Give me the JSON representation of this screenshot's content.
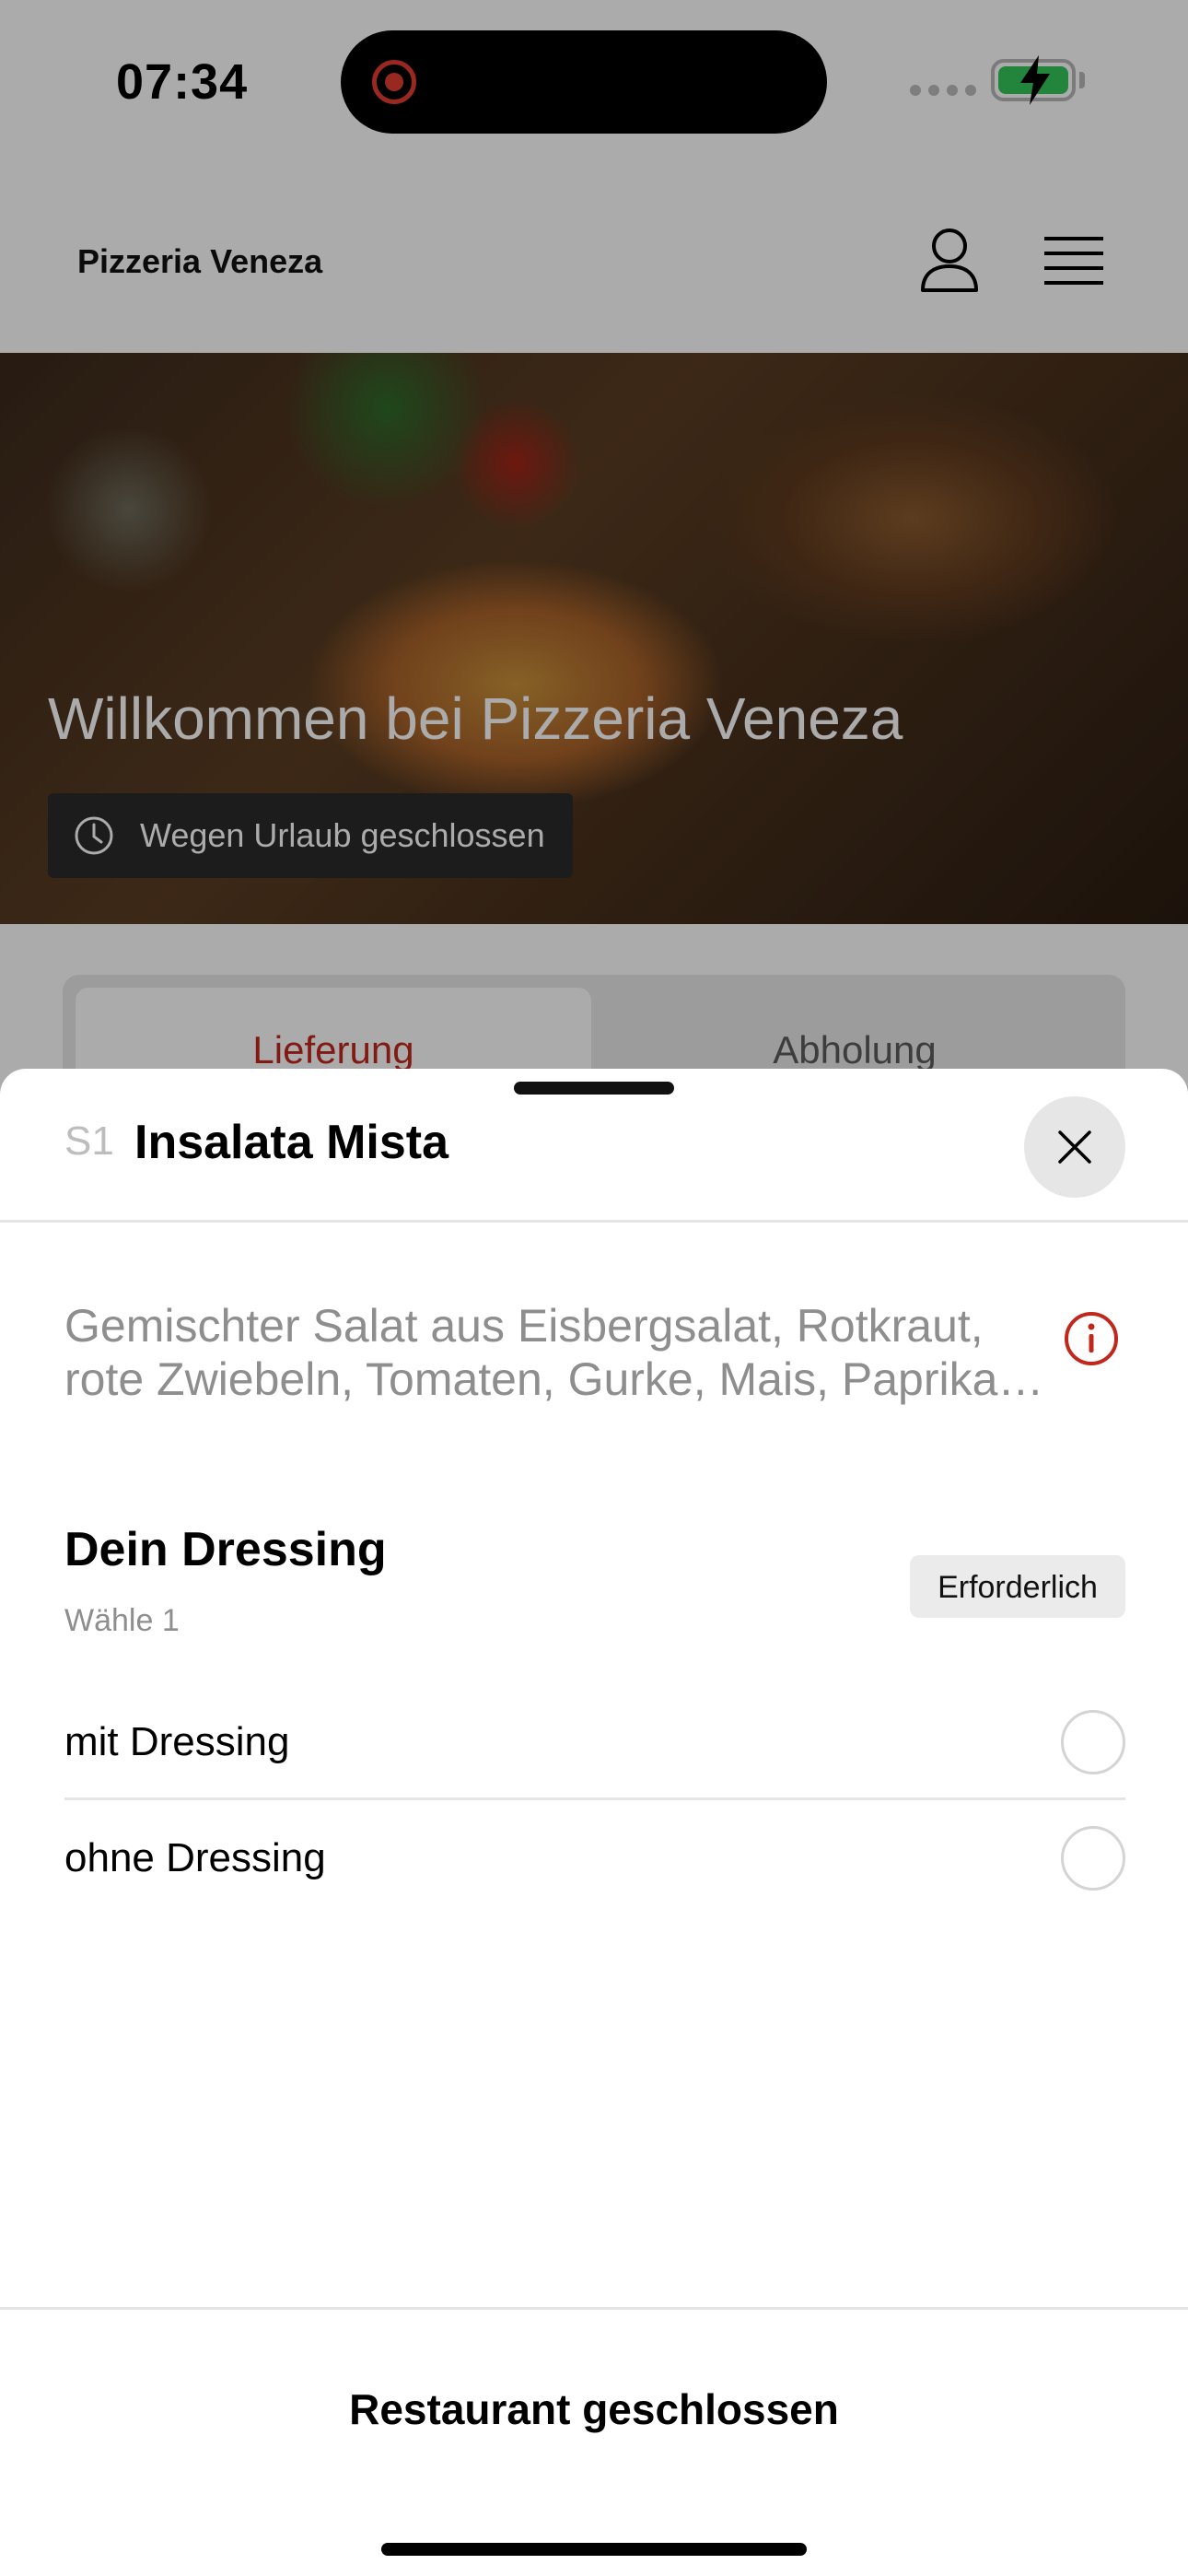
{
  "status_bar": {
    "time": "07:34"
  },
  "header": {
    "brand": "Pizzeria Veneza"
  },
  "hero": {
    "title": "Willkommen bei Pizzeria Veneza",
    "status_badge": "Wegen Urlaub geschlossen"
  },
  "order_tabs": {
    "delivery": "Lieferung",
    "pickup": "Abholung"
  },
  "sheet": {
    "item_code": "S1",
    "item_name": "Insalata Mista",
    "description_line1": "Gemischter Salat aus Eisbergsalat, Rotkraut,",
    "description_line2": "rote Zwiebeln, Tomaten, Gurke, Mais, Paprika…",
    "option_group": {
      "title": "Dein Dressing",
      "subtitle": "Wähle 1",
      "required_label": "Erforderlich",
      "options": [
        {
          "label": "mit Dressing",
          "selected": false
        },
        {
          "label": "ohne Dressing",
          "selected": false
        }
      ]
    },
    "footer_cta": "Restaurant geschlossen"
  },
  "colors": {
    "accent": "#c0281c",
    "muted_text": "#8e8e8e",
    "battery_green": "#34c759",
    "record_red": "#e43d30"
  }
}
